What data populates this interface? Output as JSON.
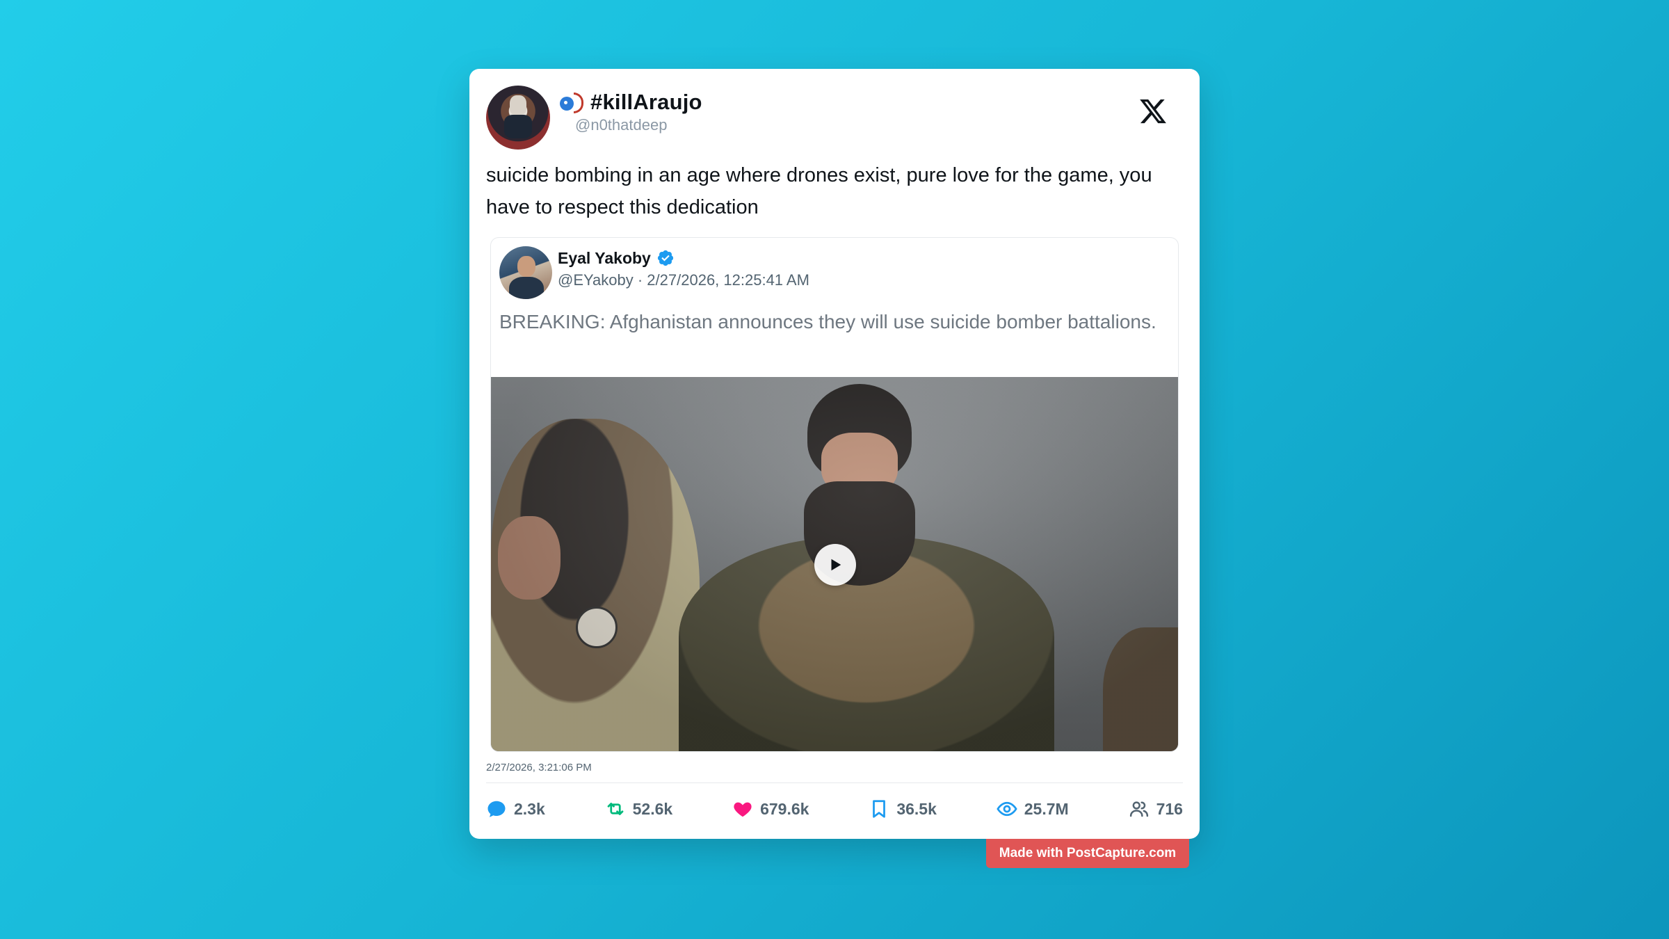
{
  "author": {
    "display_name": "#killAraujo",
    "handle": "@n0thatdeep",
    "emoji_icon": "microphone-person-emoji"
  },
  "tweet": {
    "text": "suicide bombing in an age where drones exist, pure love for the game, you have to respect this dedication",
    "timestamp": "2/27/2026, 3:21:06 PM"
  },
  "quoted": {
    "display_name": "Eyal Yakoby",
    "verified": true,
    "meta": "@EYakoby · 2/27/2026, 12:25:41 AM",
    "text": "BREAKING: Afghanistan announces they will use suicide bomber battalions.",
    "media_type": "video"
  },
  "stats": {
    "replies": "2.3k",
    "retweets": "52.6k",
    "likes": "679.6k",
    "bookmarks": "36.5k",
    "views": "25.7M",
    "community": "716"
  },
  "colors": {
    "reply": "#1d9bf0",
    "retweet": "#00ba7c",
    "like": "#f91880",
    "bookmark": "#1d9bf0",
    "views": "#1d9bf0",
    "watermark": "#e05555"
  },
  "watermark": "Made with PostCapture.com"
}
